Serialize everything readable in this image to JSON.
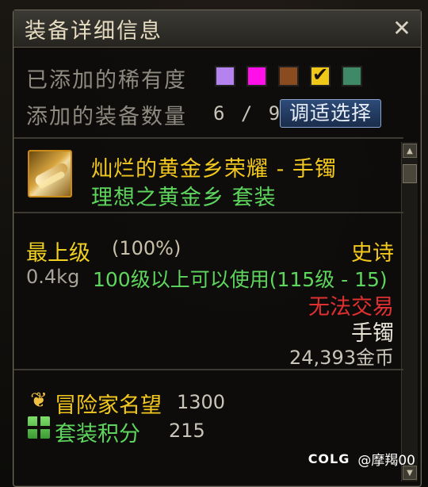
{
  "window": {
    "title": "装备详细信息"
  },
  "filter": {
    "rarity_label": "已添加的稀有度",
    "rarity_swatches": [
      {
        "color": "#b483f0",
        "checked": false
      },
      {
        "color": "#ff10e8",
        "checked": false
      },
      {
        "color": "#8a4c1e",
        "checked": false
      },
      {
        "color": "#f0c818",
        "checked": true
      },
      {
        "color": "#3f8a66",
        "checked": false
      }
    ],
    "count_label": "添加的装备数量",
    "count_value": "6 / 9",
    "adjust_button": "调适选择"
  },
  "item": {
    "icon": "gold-bracelet-icon",
    "name": "灿烂的黄金乡荣耀 - 手镯",
    "set_name": "理想之黄金乡  套装",
    "grade": "最上级",
    "grade_percent": "(100%)",
    "rarity": "史诗",
    "weight": "0.4kg",
    "level_requirement": "100级以上可以使用(115级 - 15)",
    "trade_status": "无法交易",
    "slot": "手镯",
    "price": "24,393金币"
  },
  "stats": {
    "fame_icon": "laurel-icon",
    "fame_label": "冒险家名望",
    "fame_value": "1300",
    "set_points_icon": "set-points-icon",
    "set_points_label": "套装积分",
    "set_points_value": "215"
  },
  "watermark": {
    "logo": "COLG",
    "user": "@摩羯00"
  },
  "colors": {
    "epic": "#f3c81e",
    "set_green": "#5ed65e",
    "untradable_red": "#e03030"
  }
}
